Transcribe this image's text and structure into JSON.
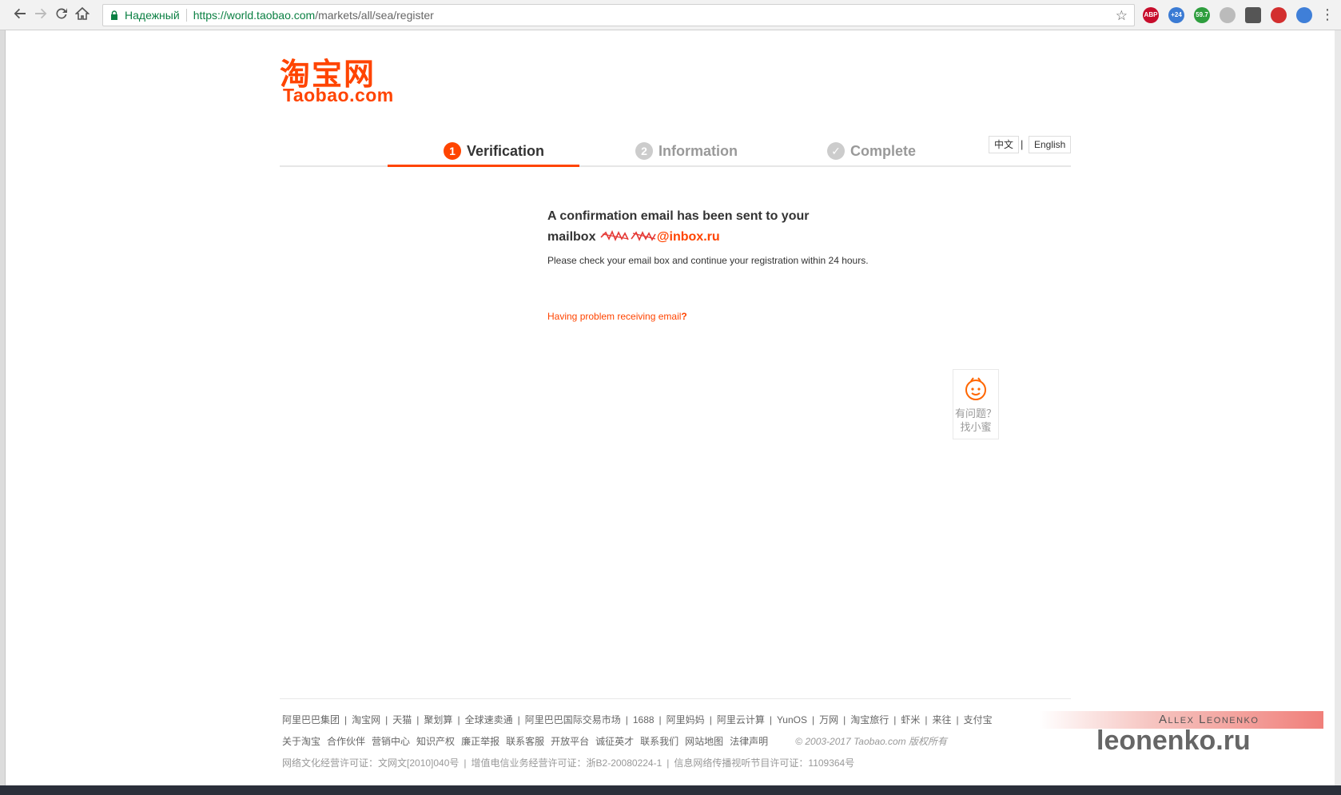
{
  "browser": {
    "secure_label": "Надежный",
    "url_host": "https://world.taobao.com",
    "url_path": "/markets/all/sea/register",
    "extensions": [
      {
        "name": "adblock-plus-icon",
        "label": "ABP",
        "color": "#c70d2c"
      },
      {
        "name": "cloud-extension-icon",
        "label": "+24",
        "color": "#3b7bd4"
      },
      {
        "name": "green-extension-icon",
        "label": "59.7",
        "color": "#2e9e3e"
      },
      {
        "name": "cursor-extension-icon",
        "label": "",
        "color": "#bbbbbb"
      },
      {
        "name": "shield-extension-icon",
        "label": "",
        "color": "#555555"
      },
      {
        "name": "red-circle-extension-icon",
        "label": "",
        "color": "#d32f2f"
      },
      {
        "name": "blue-circle-extension-icon",
        "label": "",
        "color": "#3f7fd8"
      }
    ]
  },
  "logo": {
    "cn": "淘宝网",
    "en": "Taobao.com"
  },
  "steps": {
    "step1": {
      "num": "1",
      "label": "Verification"
    },
    "step2": {
      "num": "2",
      "label": "Information"
    },
    "step3": {
      "num": "✓",
      "label": "Complete"
    }
  },
  "lang": {
    "zh": "中文",
    "sep": "|",
    "en": "English"
  },
  "message": {
    "title_line1": "A confirmation email has been sent to your",
    "title_line2": "mailbox",
    "email_domain": "@inbox.ru",
    "sub": "Please check your email box and continue your registration within 24 hours.",
    "problem_link": "Having problem receiving email",
    "problem_mark": "?"
  },
  "helper": {
    "line1": "有问题？",
    "line2": "找小蜜"
  },
  "footer": {
    "row1": [
      "阿里巴巴集团",
      "淘宝网",
      "天猫",
      "聚划算",
      "全球速卖通",
      "阿里巴巴国际交易市场",
      "1688",
      "阿里妈妈",
      "阿里云计算",
      "YunOS",
      "万网",
      "淘宝旅行",
      "虾米",
      "来往",
      "支付宝"
    ],
    "row2": [
      "关于淘宝",
      "合作伙伴",
      "营销中心",
      "知识产权",
      "廉正举报",
      "联系客服",
      "开放平台",
      "诚征英才",
      "联系我们",
      "网站地图",
      "法律声明"
    ],
    "copyright": "© 2003-2017 Taobao.com 版权所有",
    "row3": [
      "网络文化经营许可证：",
      "文网文[2010]040号",
      "增值电信业务经营许可证：浙B2-20080224-1",
      "信息网络传播视听节目许可证：1109364号"
    ]
  },
  "watermark": {
    "name": "Allex Leonenko",
    "site": "leonenko.ru"
  }
}
